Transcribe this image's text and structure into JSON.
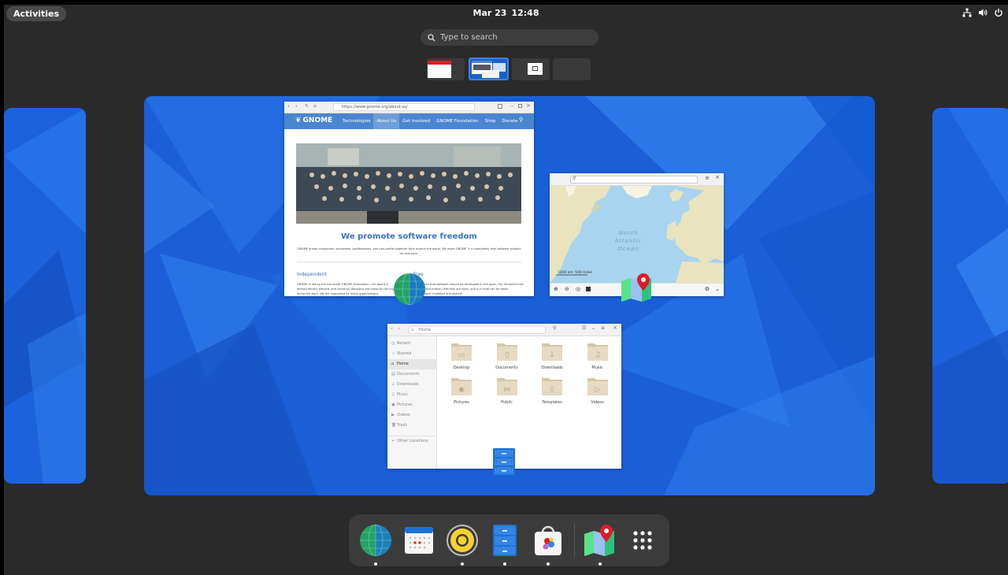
{
  "topbar": {
    "activities_label": "Activities",
    "date": "Mar 23",
    "time": "12:48",
    "icons": [
      "network-icon",
      "volume-icon",
      "power-icon"
    ]
  },
  "search": {
    "placeholder": "Type to search"
  },
  "browser": {
    "url": "https://www.gnome.org/about-us/",
    "logo": "GNOME",
    "nav": [
      "Technologies",
      "About Us",
      "Get Involved",
      "GNOME Foundation",
      "Shop",
      "Donate"
    ],
    "headline": "We promote software freedom",
    "intro": "GNOME brings companies, volunteers, professionals, and non-profits together from around the world. We make GNOME 3: a completely free software solution for everyone.",
    "col1_title": "Independent",
    "col2_title": "Free",
    "col1_text": "GNOME is led by the non-profit GNOME Foundation. Our board is democratically elected, and technical decisions are made by the engineers doing the work. We are supported by many organizations.",
    "col2_text": "We believe that software should be developed in the open. Our infrastructure and communication channels are open, and our code can be freely downloaded, modified and shared."
  },
  "maps": {
    "ocean_label": [
      "North",
      "Atlantic",
      "Ocean"
    ],
    "scale_km": "1000 km",
    "scale_mi": "500 miles"
  },
  "files": {
    "location": "Home",
    "sidebar": [
      "Recent",
      "Starred",
      "Home",
      "Documents",
      "Downloads",
      "Music",
      "Pictures",
      "Videos",
      "Trash",
      "Other Locations"
    ],
    "folders": [
      "Desktop",
      "Documents",
      "Downloads",
      "Music",
      "Pictures",
      "Public",
      "Templates",
      "Videos"
    ]
  },
  "dock": {
    "apps": [
      "web-browser-icon",
      "calendar-icon",
      "rhythmbox-icon",
      "files-icon",
      "software-icon",
      "maps-icon",
      "show-apps-icon"
    ]
  },
  "colors": {
    "accent": "#3584e4",
    "wallpaper": "#1a5fd8",
    "gnome_header": "#4a86cf",
    "panel": "#2a2a2a",
    "dock": "#3b3b3b"
  }
}
